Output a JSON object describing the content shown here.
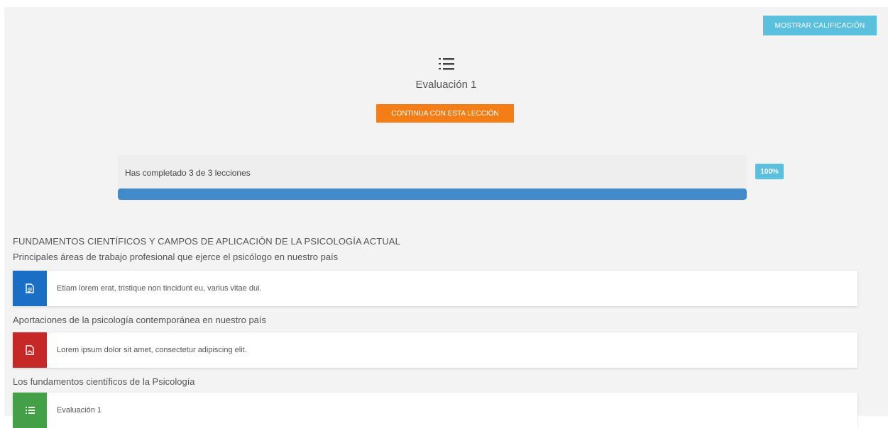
{
  "header": {
    "grade_button_label": "MOSTRAR CALIFICACIÓN",
    "evaluation_title": "Evaluación 1",
    "continue_button_label": "CONTINUA CON ESTA LECCIÓN",
    "header_icon": "list-icon"
  },
  "progress": {
    "text": "Has completado 3 de 3 lecciones",
    "percent_label": "100%",
    "fraction": 1.0
  },
  "course": {
    "title": "FUNDAMENTOS CIENTÍFICOS Y CAMPOS DE APLICACIÓN DE LA PSICOLOGÍA ACTUAL",
    "sections": [
      {
        "title": "Principales áreas de trabajo profesional que ejerce el psicólogo en nuestro país",
        "lesson": {
          "text": "Etiam lorem erat, tristique non tincidunt eu, varius vitae dui.",
          "icon": "document-icon",
          "color": "#1a6fc4"
        }
      },
      {
        "title": "Aportaciones de la psicología contemporánea en nuestro país",
        "lesson": {
          "text": "Lorem ipsum dolor sit amet, consectetur adipiscing elit.",
          "icon": "pdf-icon",
          "color": "#c62828"
        }
      },
      {
        "title": "Los fundamentos científicos de la Psicología",
        "lesson": {
          "text": "Evaluación 1",
          "icon": "list-icon",
          "color": "#43a047"
        }
      }
    ]
  },
  "colors": {
    "accent_blue": "#5bc0de",
    "progress_blue": "#428bca",
    "orange": "#f47d16"
  }
}
